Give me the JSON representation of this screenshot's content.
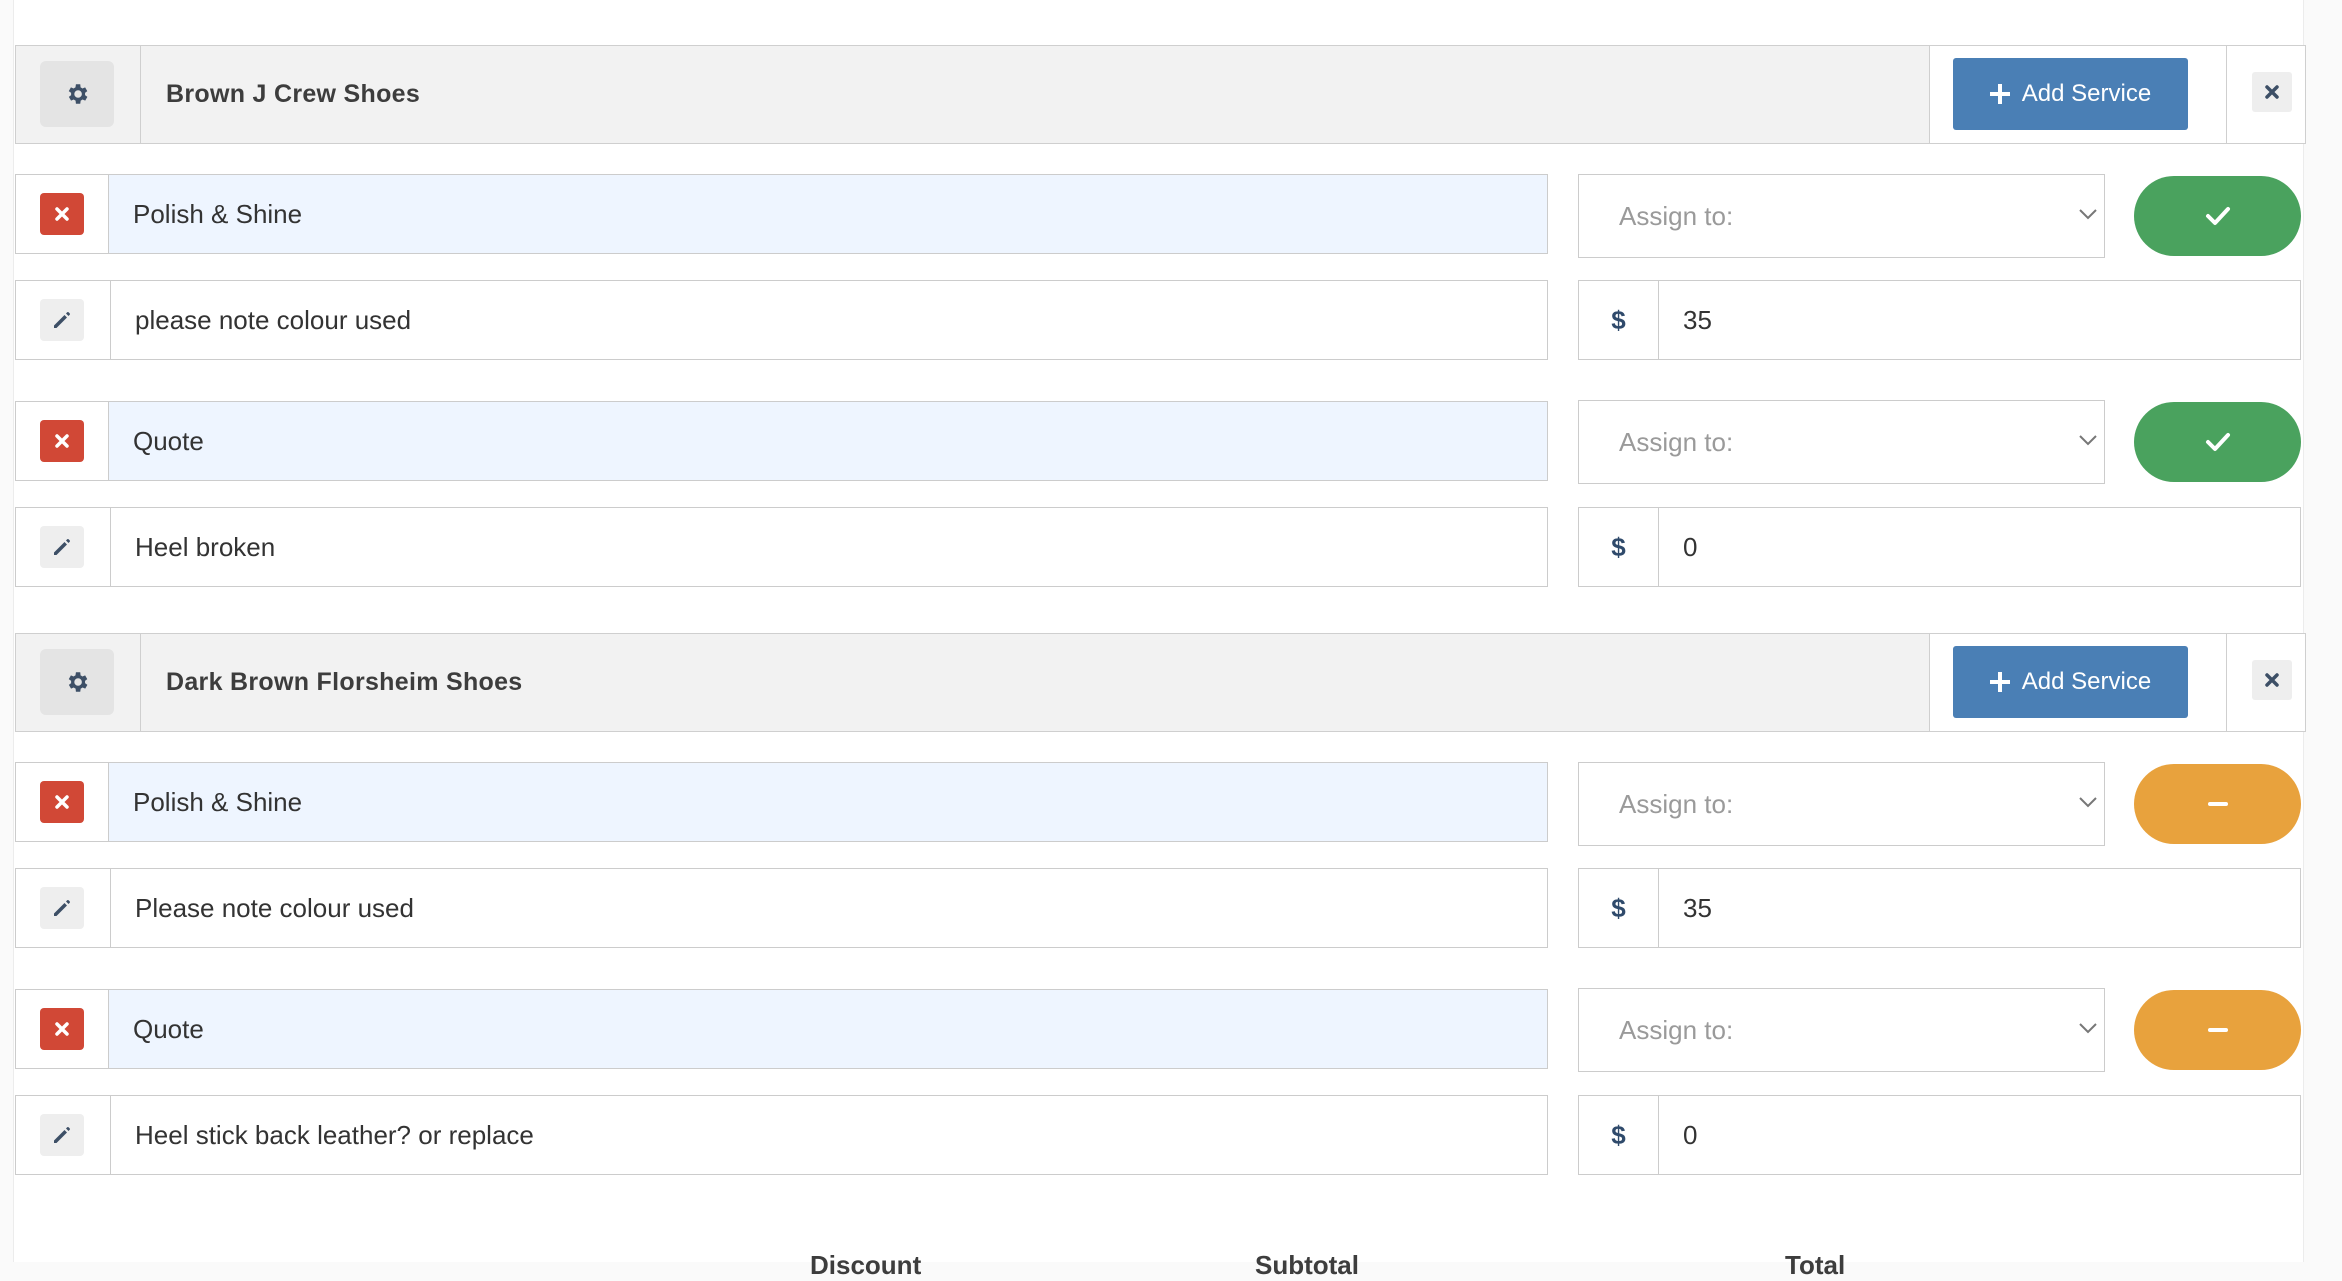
{
  "items": [
    {
      "title": "Brown J Crew Shoes",
      "add_label": "Add Service",
      "services": [
        {
          "name": "Polish & Shine",
          "assign_placeholder": "Assign to:",
          "status": "done",
          "note": "please note colour used",
          "currency": "$",
          "price": "35"
        },
        {
          "name": "Quote",
          "assign_placeholder": "Assign to:",
          "status": "done",
          "note": "Heel broken",
          "currency": "$",
          "price": "0"
        }
      ]
    },
    {
      "title": "Dark Brown Florsheim Shoes",
      "add_label": "Add Service",
      "services": [
        {
          "name": "Polish & Shine",
          "assign_placeholder": "Assign to:",
          "status": "pending",
          "note": "Please note colour used",
          "currency": "$",
          "price": "35"
        },
        {
          "name": "Quote",
          "assign_placeholder": "Assign to:",
          "status": "pending",
          "note": "Heel stick back leather? or replace",
          "currency": "$",
          "price": "0"
        }
      ]
    }
  ],
  "colors": {
    "done": "#4aa25e",
    "pending": "#e8a23d",
    "remove": "#d14836",
    "primary": "#4a7fb5"
  },
  "footer": {
    "labels": [
      "Discount",
      "Subtotal",
      "Total"
    ]
  }
}
